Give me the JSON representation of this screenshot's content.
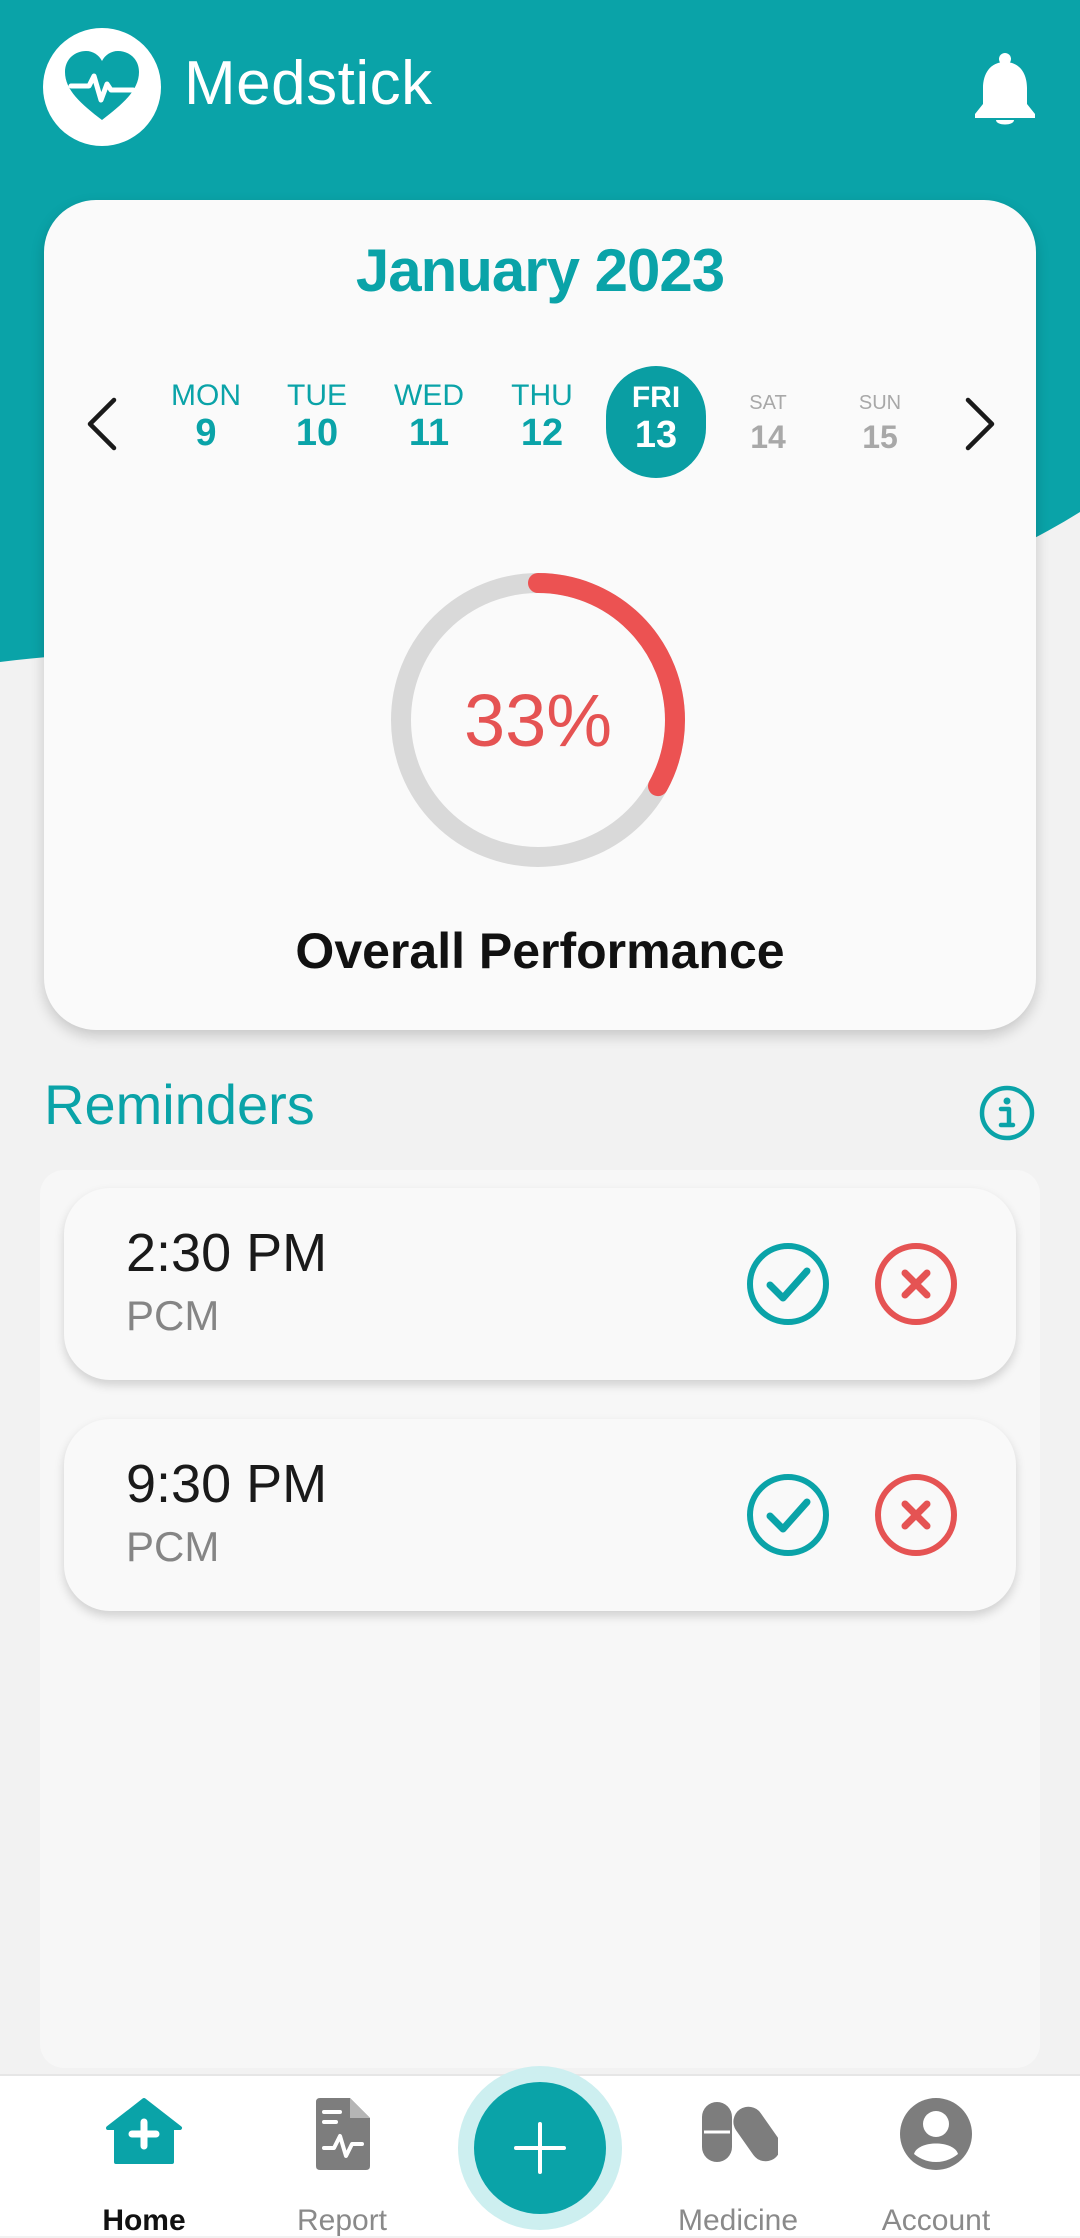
{
  "app": {
    "title": "Medstick"
  },
  "colors": {
    "primary": "#0aa3a8",
    "accent_red": "#e55353",
    "background": "#f2f2f2"
  },
  "icons": {
    "logo": "heart-pulse-icon",
    "notification": "bell-icon",
    "prev": "chevron-left-icon",
    "next": "chevron-right-icon",
    "info": "info-circle-icon",
    "take": "check-circle-icon",
    "skip": "x-circle-icon"
  },
  "calendar": {
    "month": "January 2023",
    "days": [
      {
        "name": "MON",
        "date": "9"
      },
      {
        "name": "TUE",
        "date": "10"
      },
      {
        "name": "WED",
        "date": "11"
      },
      {
        "name": "THU",
        "date": "12"
      },
      {
        "name": "FRI",
        "date": "13",
        "selected": true
      },
      {
        "name": "SAT",
        "date": "14"
      },
      {
        "name": "SUN",
        "date": "15"
      }
    ]
  },
  "performance": {
    "value": 0.33,
    "value_label": "33%",
    "label": "Overall Performance"
  },
  "reminders": {
    "title": "Reminders",
    "items": [
      {
        "time": "2:30 PM",
        "medicine": "PCM"
      },
      {
        "time": "9:30 PM",
        "medicine": "PCM"
      }
    ]
  },
  "nav": {
    "items": [
      {
        "label": "Home",
        "icon": "home-icon",
        "active": true
      },
      {
        "label": "Report",
        "icon": "report-icon"
      },
      {
        "label": "Medicine",
        "icon": "pills-icon"
      },
      {
        "label": "Account",
        "icon": "account-icon"
      }
    ],
    "fab_icon": "plus-icon"
  }
}
